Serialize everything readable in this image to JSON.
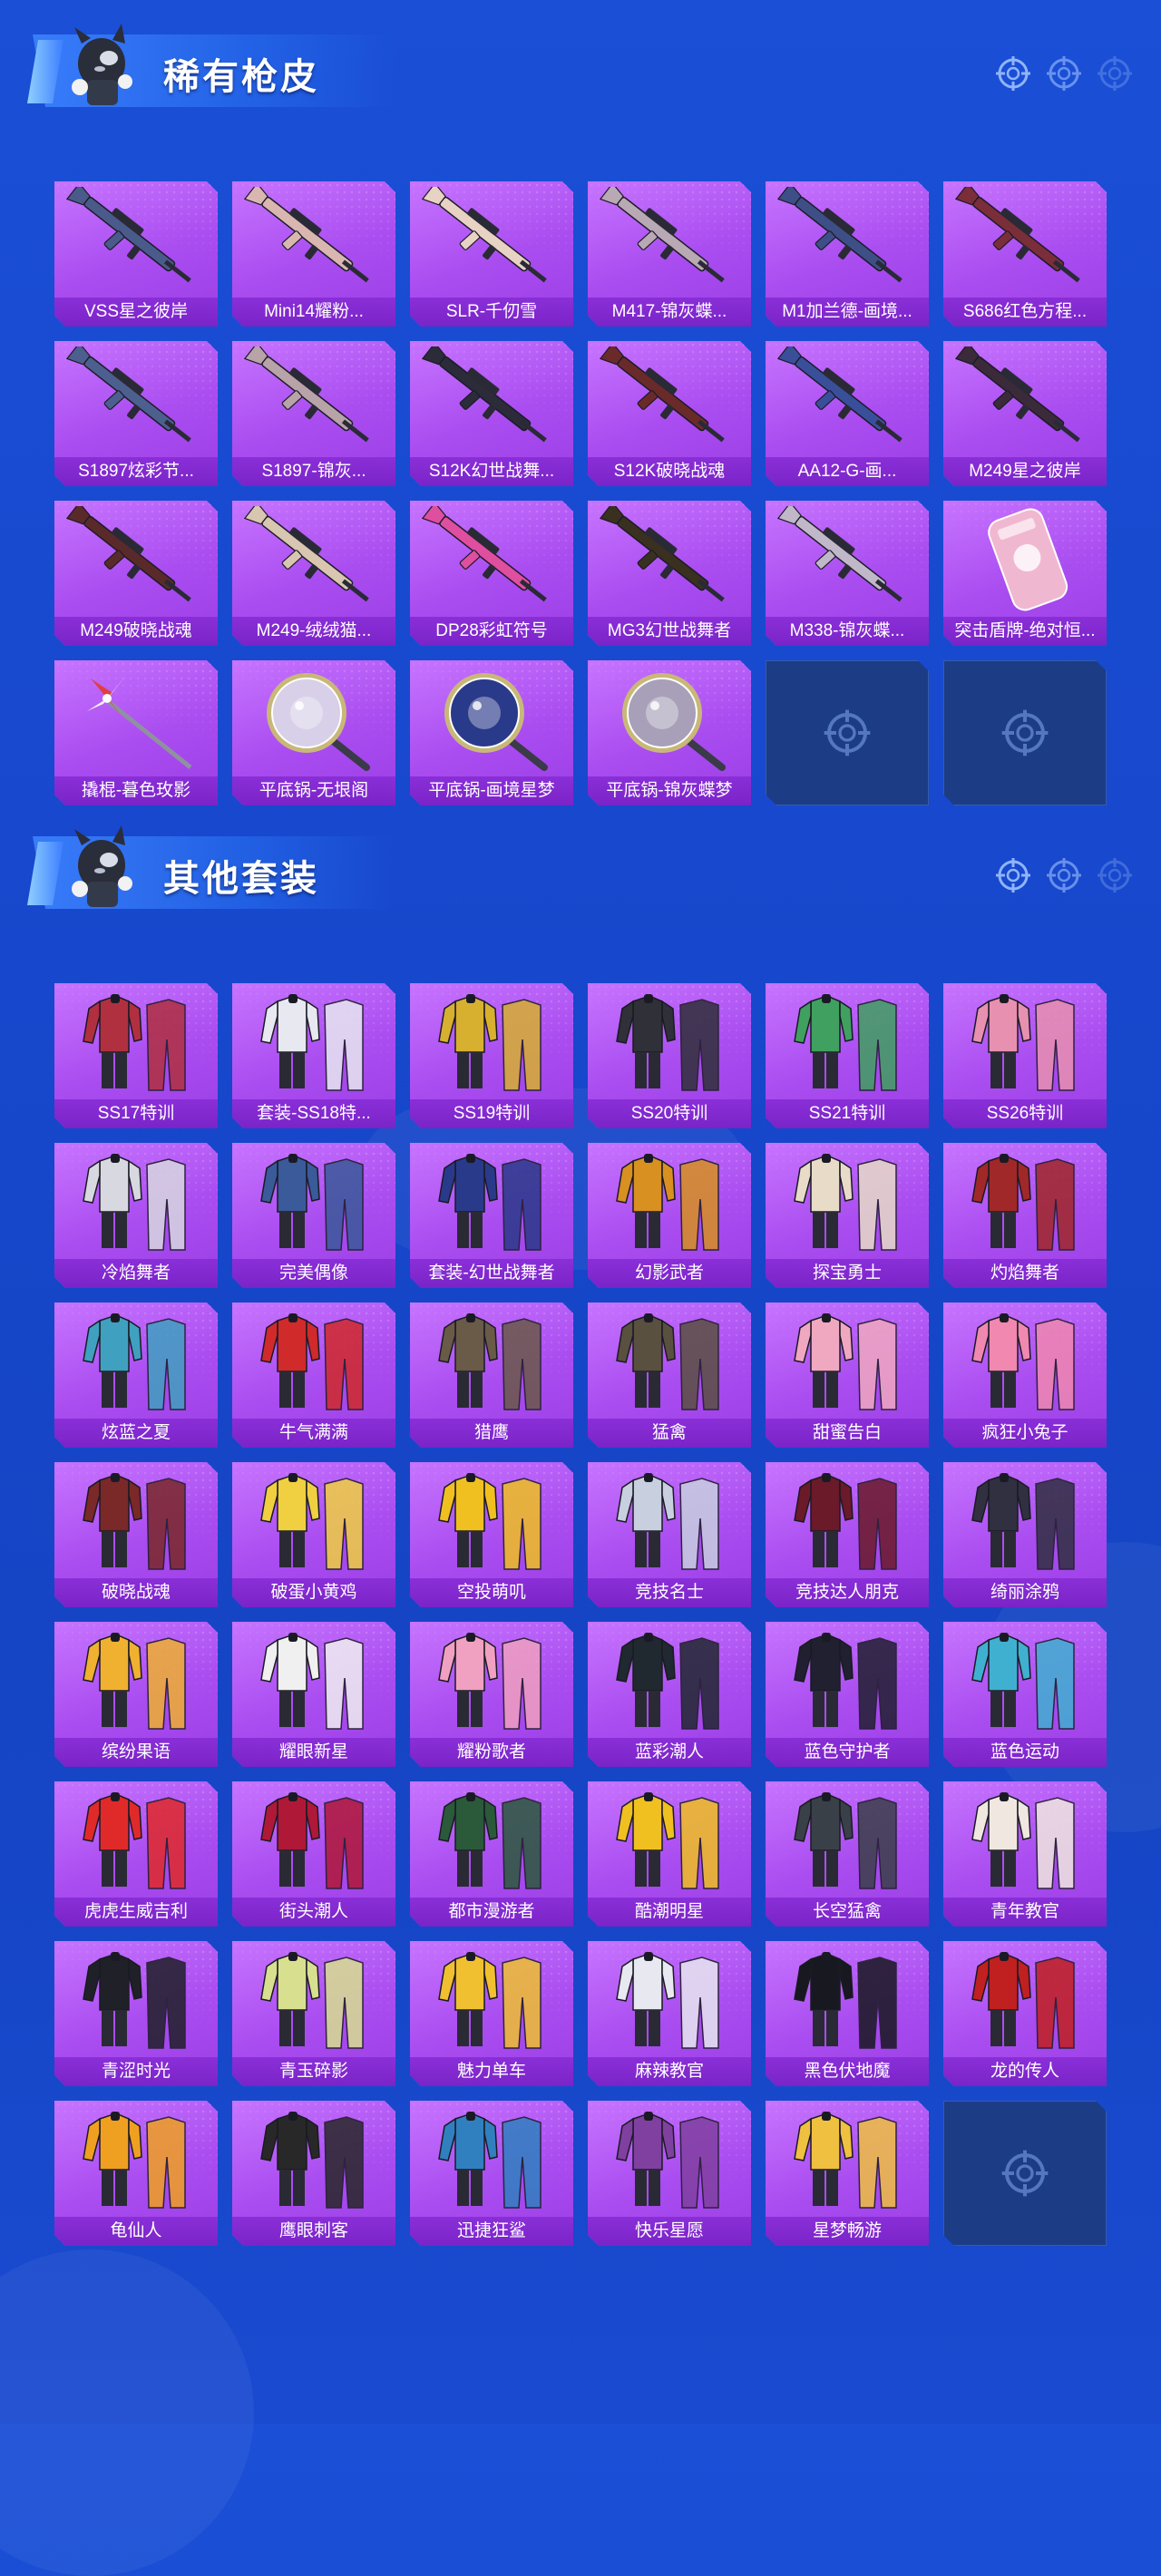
{
  "sections": [
    {
      "title": "稀有枪皮",
      "items": [
        {
          "label": "VSS星之彼岸",
          "kind": "gun",
          "color": "#4a5a8a"
        },
        {
          "label": "Mini14耀粉...",
          "kind": "gun",
          "color": "#d9b7b0"
        },
        {
          "label": "SLR-千仞雪",
          "kind": "gun",
          "color": "#e8d2c4"
        },
        {
          "label": "M417-锦灰蝶...",
          "kind": "gun",
          "color": "#b9a9b4"
        },
        {
          "label": "M1加兰德-画境...",
          "kind": "gun",
          "color": "#3d4f86"
        },
        {
          "label": "S686红色方程...",
          "kind": "gun",
          "color": "#7a2e3a"
        },
        {
          "label": "S1897炫彩节...",
          "kind": "gun",
          "color": "#4d5f8f"
        },
        {
          "label": "S1897-锦灰...",
          "kind": "gun",
          "color": "#b8a3a8"
        },
        {
          "label": "S12K幻世战舞...",
          "kind": "gun",
          "color": "#2b2b3a"
        },
        {
          "label": "S12K破晓战魂",
          "kind": "gun",
          "color": "#6a2a2a"
        },
        {
          "label": "AA12-G-画...",
          "kind": "gun",
          "color": "#3a4f9a"
        },
        {
          "label": "M249星之彼岸",
          "kind": "gun",
          "color": "#3a2a3a"
        },
        {
          "label": "M249破晓战魂",
          "kind": "gun",
          "color": "#5a2a2a"
        },
        {
          "label": "M249-绒绒猫...",
          "kind": "gun",
          "color": "#d8c6b0"
        },
        {
          "label": "DP28彩虹符号",
          "kind": "gun",
          "color": "#e04ea0"
        },
        {
          "label": "MG3幻世战舞者",
          "kind": "gun",
          "color": "#3a3020"
        },
        {
          "label": "M338-锦灰蝶...",
          "kind": "gun",
          "color": "#c0b8c8"
        },
        {
          "label": "突击盾牌-绝对恒...",
          "kind": "shield",
          "color": "#f0b8d0"
        },
        {
          "label": "撬棍-暮色玫影",
          "kind": "crowbar",
          "color": "#e04040"
        },
        {
          "label": "平底锅-无垠阁",
          "kind": "pan",
          "color": "#d8d0e8"
        },
        {
          "label": "平底锅-画境星梦",
          "kind": "pan",
          "color": "#2a3a8a"
        },
        {
          "label": "平底锅-锦灰蝶梦",
          "kind": "pan",
          "color": "#a8a0b8"
        }
      ],
      "empty_slots": 2
    },
    {
      "title": "其他套装",
      "items": [
        {
          "label": "SS17特训",
          "kind": "suit",
          "color": "#b03040"
        },
        {
          "label": "套装-SS18特...",
          "kind": "suit",
          "color": "#e8e8f0"
        },
        {
          "label": "SS19特训",
          "kind": "suit",
          "color": "#d8b030"
        },
        {
          "label": "SS20特训",
          "kind": "suit",
          "color": "#303038"
        },
        {
          "label": "SS21特训",
          "kind": "suit",
          "color": "#40a060"
        },
        {
          "label": "SS26特训",
          "kind": "suit",
          "color": "#e890b0"
        },
        {
          "label": "冷焰舞者",
          "kind": "suit",
          "color": "#d8d8e0"
        },
        {
          "label": "完美偶像",
          "kind": "suit",
          "color": "#3a5a9a"
        },
        {
          "label": "套装-幻世战舞者",
          "kind": "suit",
          "color": "#2a3a8a"
        },
        {
          "label": "幻影武者",
          "kind": "suit",
          "color": "#d89020"
        },
        {
          "label": "探宝勇士",
          "kind": "suit",
          "color": "#e8dcc8"
        },
        {
          "label": "灼焰舞者",
          "kind": "suit",
          "color": "#a02828"
        },
        {
          "label": "炫蓝之夏",
          "kind": "suit",
          "color": "#40a0c0"
        },
        {
          "label": "牛气满满",
          "kind": "suit",
          "color": "#d02a2a"
        },
        {
          "label": "猎鹰",
          "kind": "suit",
          "color": "#6a5a48"
        },
        {
          "label": "猛禽",
          "kind": "suit",
          "color": "#5a5040"
        },
        {
          "label": "甜蜜告白",
          "kind": "suit",
          "color": "#f0a8c0"
        },
        {
          "label": "疯狂小兔子",
          "kind": "suit",
          "color": "#f088b0"
        },
        {
          "label": "破晓战魂",
          "kind": "suit",
          "color": "#7a2828"
        },
        {
          "label": "破蛋小黄鸡",
          "kind": "suit",
          "color": "#f0d040"
        },
        {
          "label": "空投萌叽",
          "kind": "suit",
          "color": "#f0c020"
        },
        {
          "label": "竞技名士",
          "kind": "suit",
          "color": "#c8d0e0"
        },
        {
          "label": "竞技达人朋克",
          "kind": "suit",
          "color": "#6a1a28"
        },
        {
          "label": "绮丽涂鸦",
          "kind": "suit",
          "color": "#303040"
        },
        {
          "label": "缤纷果语",
          "kind": "suit",
          "color": "#f0b030"
        },
        {
          "label": "耀眼新星",
          "kind": "suit",
          "color": "#f0f0f0"
        },
        {
          "label": "耀粉歌者",
          "kind": "suit",
          "color": "#f0a0c0"
        },
        {
          "label": "蓝彩潮人",
          "kind": "suit",
          "color": "#202830"
        },
        {
          "label": "蓝色守护者",
          "kind": "suit",
          "color": "#202030"
        },
        {
          "label": "蓝色运动",
          "kind": "suit",
          "color": "#40b0d0"
        },
        {
          "label": "虎虎生威吉利",
          "kind": "suit",
          "color": "#e02a2a"
        },
        {
          "label": "街头潮人",
          "kind": "suit",
          "color": "#b01838"
        },
        {
          "label": "都市漫游者",
          "kind": "suit",
          "color": "#2a5a3a"
        },
        {
          "label": "酷潮明星",
          "kind": "suit",
          "color": "#f0c020"
        },
        {
          "label": "长空猛禽",
          "kind": "suit",
          "color": "#3a4048"
        },
        {
          "label": "青年教官",
          "kind": "suit",
          "color": "#f0e8e0"
        },
        {
          "label": "青涩时光",
          "kind": "suit",
          "color": "#202028"
        },
        {
          "label": "青玉碎影",
          "kind": "suit",
          "color": "#d8e090"
        },
        {
          "label": "魅力单车",
          "kind": "suit",
          "color": "#f0c030"
        },
        {
          "label": "麻辣教官",
          "kind": "suit",
          "color": "#e8e8f0"
        },
        {
          "label": "黑色伏地魔",
          "kind": "suit",
          "color": "#181820"
        },
        {
          "label": "龙的传人",
          "kind": "suit",
          "color": "#c02020"
        },
        {
          "label": "龟仙人",
          "kind": "suit",
          "color": "#f0a020"
        },
        {
          "label": "鹰眼刺客",
          "kind": "suit",
          "color": "#282828"
        },
        {
          "label": "迅捷狂鲨",
          "kind": "suit",
          "color": "#3080c0"
        },
        {
          "label": "快乐星愿",
          "kind": "suit",
          "color": "#8040a0"
        },
        {
          "label": "星梦畅游",
          "kind": "suit",
          "color": "#f0c040"
        }
      ],
      "empty_slots": 1
    }
  ],
  "colors": {
    "background": "#1747cc",
    "card": "#b35ef5",
    "label_bar": "#7a24c8",
    "empty": "#1c3c86"
  },
  "icons": [
    "crosshair-icon",
    "mascot-avatar"
  ]
}
